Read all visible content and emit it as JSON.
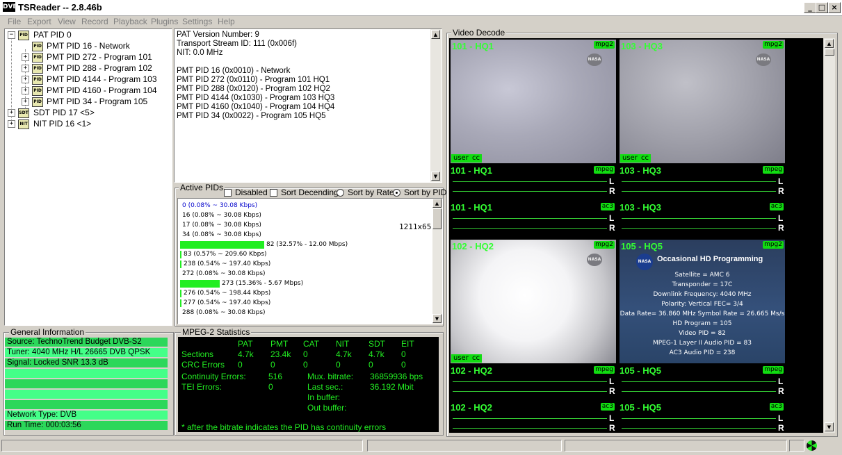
{
  "window": {
    "title": "TSReader -- 2.8.46b",
    "logo": "DVB",
    "minimize": "_",
    "restore": "□",
    "close": "×"
  },
  "menu": [
    "File",
    "Export",
    "View",
    "Record",
    "Playback",
    "Plugins",
    "Settings",
    "Help"
  ],
  "tree": {
    "root": "PAT PID 0",
    "children": [
      "PMT PID 16 - Network",
      "PMT PID 272 - Program 101",
      "PMT PID 288 - Program 102",
      "PMT PID 4144 - Program 103",
      "PMT PID 4160 - Program 104",
      "PMT PID 34 - Program 105"
    ],
    "others": [
      "SDT PID 17 <5>",
      "NIT PID 16 <1>"
    ],
    "icon_pid": "PID",
    "icon_sdt": "SDT",
    "icon_nit": "NIT"
  },
  "details": [
    "PAT Version Number: 9",
    "Transport Stream ID: 111 (0x006f)",
    "NIT: 0.0 MHz",
    "",
    "PMT PID 16 (0x0010) - Network",
    "PMT PID 272 (0x0110) - Program 101 HQ1",
    "PMT PID 288 (0x0120) - Program 102 HQ2",
    "PMT PID 4144 (0x1030) - Program 103 HQ3",
    "PMT PID 4160 (0x1040) - Program 104 HQ4",
    "PMT PID 34 (0x0022) - Program 105 HQ5"
  ],
  "active_pids": {
    "label": "Active PIDs",
    "disabled": "Disabled",
    "sort_descending": "Sort Decending",
    "sort_by_rate": "Sort by Rate",
    "sort_by_pid": "Sort by PID",
    "overlay_text": "1211x65",
    "rows": [
      {
        "text": "0 (0.08% ~ 30.08 Kbps)",
        "bar": 0,
        "blue": true
      },
      {
        "text": "16 (0.08% ~ 30.08 Kbps)",
        "bar": 0
      },
      {
        "text": "17 (0.08% ~ 30.08 Kbps)",
        "bar": 0
      },
      {
        "text": "34 (0.08% ~ 30.08 Kbps)",
        "bar": 0
      },
      {
        "text": "82 (32.57% - 12.00 Mbps)",
        "bar": 0.3257
      },
      {
        "text": "83 (0.57% ~ 209.60 Kbps)",
        "bar": 0.0057
      },
      {
        "text": "238 (0.54% ~ 197.40 Kbps)",
        "bar": 0.0054
      },
      {
        "text": "272 (0.08% ~ 30.08 Kbps)",
        "bar": 0
      },
      {
        "text": "273 (15.36% - 5.67 Mbps)",
        "bar": 0.1536
      },
      {
        "text": "276 (0.54% ~ 198.44 Kbps)",
        "bar": 0.0054
      },
      {
        "text": "277 (0.54% ~ 197.40 Kbps)",
        "bar": 0.0054
      },
      {
        "text": "288 (0.08% ~ 30.08 Kbps)",
        "bar": 0
      }
    ]
  },
  "general_info": {
    "label": "General Information",
    "rows": [
      "Source: TechnoTrend Budget DVB-S2",
      "Tuner: 4040 MHz H/L 26665 DVB QPSK",
      "Signal: Locked SNR 13.3 dB",
      "",
      "",
      "",
      "",
      "Network Type: DVB",
      "Run Time: 000:03:56"
    ]
  },
  "mpeg_stats": {
    "label": "MPEG-2 Statistics",
    "headers": [
      "PAT",
      "PMT",
      "CAT",
      "NIT",
      "SDT",
      "EIT"
    ],
    "sections_label": "Sections",
    "sections": [
      "4.7k",
      "23.4k",
      "0",
      "4.7k",
      "4.7k",
      "0"
    ],
    "crc_label": "CRC Errors",
    "crc": [
      "0",
      "0",
      "0",
      "0",
      "0",
      "0"
    ],
    "continuity_label": "Continuity Errors:",
    "continuity": "516",
    "tei_label": "TEI Errors:",
    "tei": "0",
    "mux_label": "Mux. bitrate:",
    "mux": "36859936 bps",
    "last_label": "Last sec.:",
    "last": "36.192 Mbit",
    "inbuf_label": "In buffer:",
    "outbuf_label": "Out buffer:",
    "footnote": "* after the bitrate indicates the PID has continuity errors"
  },
  "video": {
    "label": "Video Decode",
    "tiles": [
      {
        "label": "101 - HQ1",
        "badge": "mpg2",
        "user": "user",
        "cc": "cc"
      },
      {
        "label": "103 - HQ3",
        "badge": "mpg2",
        "user": "user",
        "cc": "cc"
      },
      {
        "label": "102 - HQ2",
        "badge": "mpg2",
        "user": "user",
        "cc": "cc"
      },
      {
        "label": "105 - HQ5",
        "badge": "mpg2"
      }
    ],
    "audio": [
      {
        "label": "101 - HQ1",
        "badge": "mpeg"
      },
      {
        "label": "103 - HQ3",
        "badge": "mpeg"
      },
      {
        "label": "101 - HQ1",
        "badge": "ac3"
      },
      {
        "label": "103 - HQ3",
        "badge": "ac3"
      },
      {
        "label": "102 - HQ2",
        "badge": "mpeg"
      },
      {
        "label": "105 - HQ5",
        "badge": "mpeg"
      },
      {
        "label": "102 - HQ2",
        "badge": "ac3"
      },
      {
        "label": "105 - HQ5",
        "badge": "ac3"
      }
    ],
    "channel_left": "L",
    "channel_right": "R",
    "nasa_logo": "NASA",
    "card": {
      "title": "Occasional HD Programming",
      "lines": [
        "Satellite = AMC 6",
        "Transponder = 17C",
        "Downlink Frequency: 4040 MHz",
        "Polarity: Vertical  FEC= 3/4",
        "Data Rate= 36.860 MHz  Symbol Rate = 26.665 Ms/s",
        "HD Program = 105",
        "Video PID = 82",
        "MPEG-1 Layer II Audio PID = 83",
        "AC3 Audio PID = 238"
      ]
    }
  },
  "colors": {
    "accent_green": "#22ee22",
    "stats_bg": "#000000",
    "gi_row_a": "#2cd75a",
    "gi_row_b": "#44ff88"
  },
  "icons": {
    "status": "radiation-icon"
  }
}
